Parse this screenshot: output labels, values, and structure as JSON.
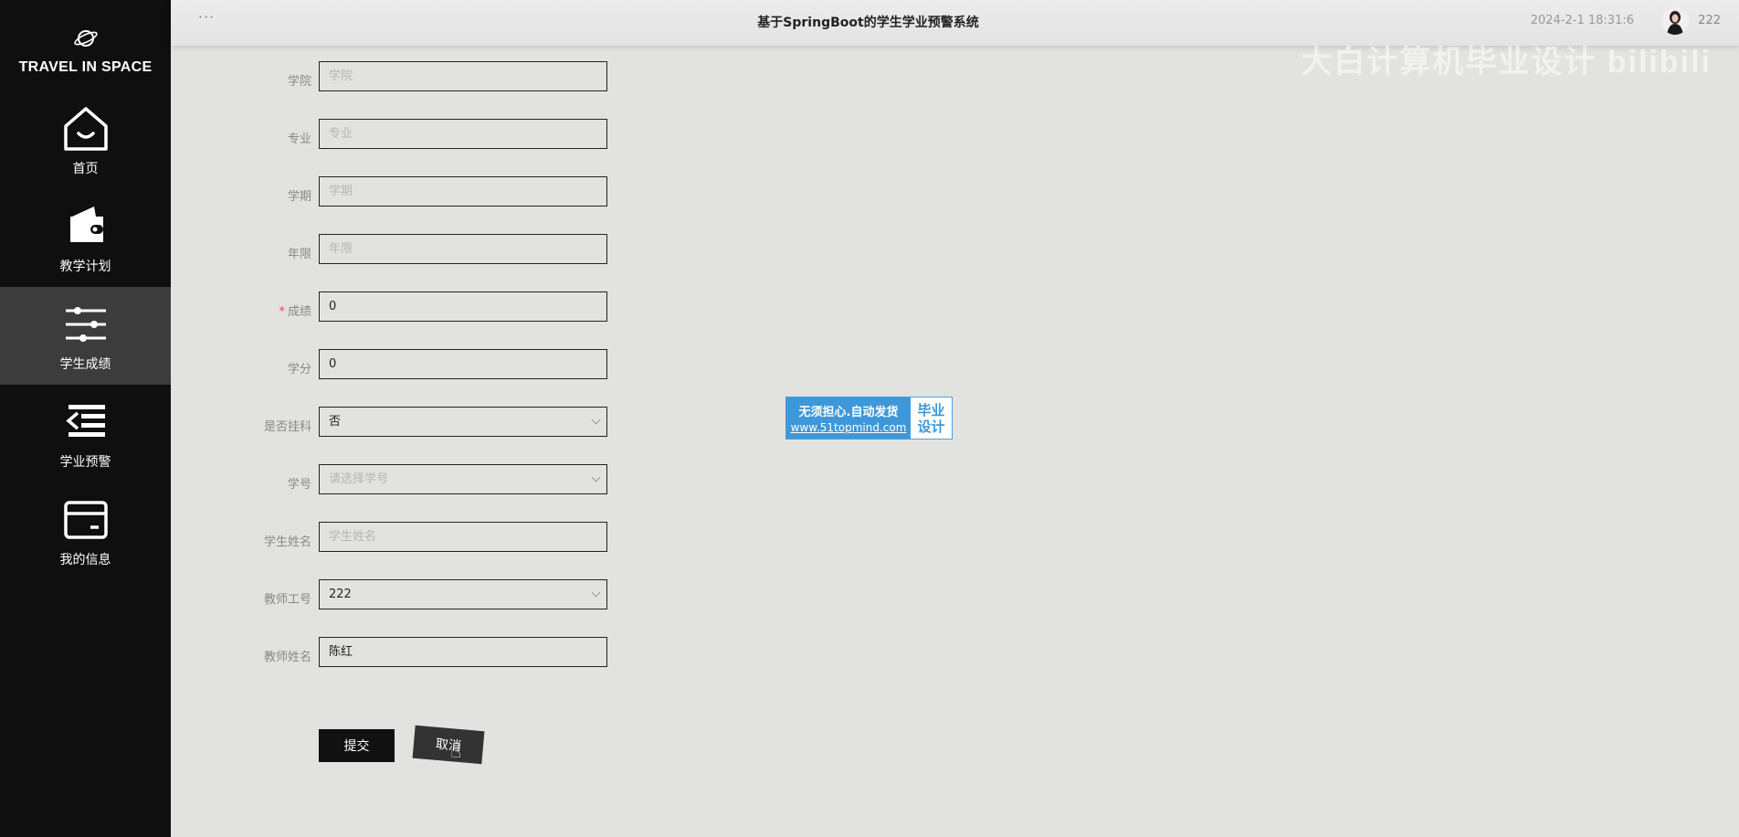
{
  "app": {
    "logo_text": "TRAVEL IN SPACE",
    "title": "基于SpringBoot的学生学业预警系统",
    "datetime": "2024-2-1 18:31:6",
    "username": "222",
    "watermark": "大白计算机毕业设计 bilibili"
  },
  "sidebar": {
    "items": [
      {
        "label": "首页",
        "icon": "home-icon"
      },
      {
        "label": "教学计划",
        "icon": "wallet-icon"
      },
      {
        "label": "学生成绩",
        "icon": "sliders-icon"
      },
      {
        "label": "学业预警",
        "icon": "indent-list-icon"
      },
      {
        "label": "我的信息",
        "icon": "card-icon"
      }
    ],
    "active_index": 2
  },
  "form": {
    "fields": [
      {
        "label": "学院",
        "value": "",
        "placeholder": "学院",
        "type": "text"
      },
      {
        "label": "专业",
        "value": "",
        "placeholder": "专业",
        "type": "text"
      },
      {
        "label": "学期",
        "value": "",
        "placeholder": "学期",
        "type": "text"
      },
      {
        "label": "年限",
        "value": "",
        "placeholder": "年限",
        "type": "text"
      },
      {
        "label": "成绩",
        "value": "0",
        "placeholder": "",
        "type": "text",
        "required": true
      },
      {
        "label": "学分",
        "value": "0",
        "placeholder": "",
        "type": "text"
      },
      {
        "label": "是否挂科",
        "value": "否",
        "placeholder": "",
        "type": "select"
      },
      {
        "label": "学号",
        "value": "",
        "placeholder": "请选择学号",
        "type": "select"
      },
      {
        "label": "学生姓名",
        "value": "",
        "placeholder": "学生姓名",
        "type": "text"
      },
      {
        "label": "教师工号",
        "value": "222",
        "placeholder": "",
        "type": "select"
      },
      {
        "label": "教师姓名",
        "value": "陈红",
        "placeholder": "",
        "type": "text"
      }
    ],
    "submit_label": "提交",
    "cancel_label": "取消"
  },
  "badge": {
    "line1": "无须担心.自动发货",
    "line2": "www.51topmind.com",
    "right1": "毕业",
    "right2": "设计"
  },
  "colors": {
    "sidebar_bg": "#0f0f0f",
    "active_bg": "#3c3c3c",
    "page_bg": "#e2e2e0",
    "badge_blue": "#3e97d8",
    "required_red": "#e84a4a"
  }
}
